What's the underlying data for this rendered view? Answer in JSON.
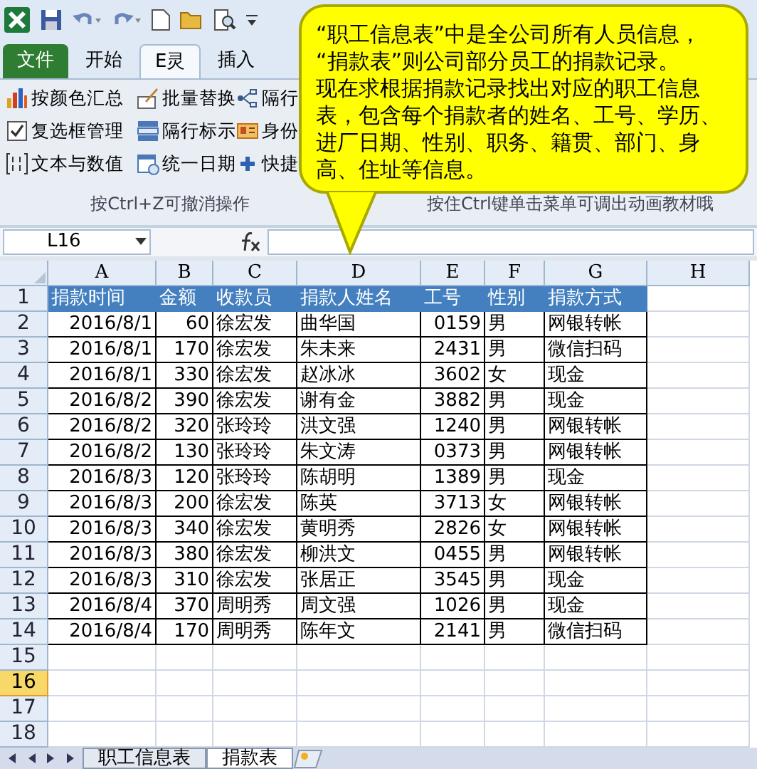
{
  "ribbon": {
    "tabs": [
      {
        "label": "文件",
        "kind": "file",
        "selected": false
      },
      {
        "label": "开始",
        "kind": "tab",
        "selected": false
      },
      {
        "label": "E灵",
        "kind": "tab",
        "selected": true
      },
      {
        "label": "插入",
        "kind": "tab",
        "selected": false
      }
    ],
    "commands": [
      {
        "label": "按颜色汇总",
        "kind": "bars"
      },
      {
        "label": "批量替换",
        "kind": "abc"
      },
      {
        "label": "隔行",
        "kind": "nodes"
      },
      {
        "label": "复选框管理",
        "kind": "checkbox"
      },
      {
        "label": "隔行标示",
        "kind": "rows"
      },
      {
        "label": "身份",
        "kind": "card"
      },
      {
        "label": "文本与数值",
        "kind": "digits"
      },
      {
        "label": "统一日期",
        "kind": "calendar"
      },
      {
        "label": "快捷",
        "kind": "plus"
      }
    ],
    "group_labels": [
      "按Ctrl+Z可撤消操作",
      "按住Ctrl键单击菜单可调出动画教材哦"
    ]
  },
  "callout": {
    "lines": [
      "“职工信息表”中是全公司所有人员信息，",
      "“捐款表”则公司部分员工的捐款记录。",
      "现在求根据捐款记录找出对应的职工信息",
      "表，包含每个捐款者的姓名、工号、学历、",
      "进厂日期、性别、职务、籍贯、部门、身",
      "高、住址等信息。"
    ]
  },
  "formula_bar": {
    "name_box": "L16"
  },
  "sheet": {
    "columns": [
      {
        "label": "A",
        "kind": "number"
      },
      {
        "label": "B",
        "kind": "number"
      },
      {
        "label": "C",
        "kind": "text"
      },
      {
        "label": "D",
        "kind": "text"
      },
      {
        "label": "E",
        "kind": "number"
      },
      {
        "label": "F",
        "kind": "text"
      },
      {
        "label": "G",
        "kind": "text"
      },
      {
        "label": "H",
        "kind": "text"
      }
    ],
    "row_headers": [
      {
        "label": "1",
        "selected": false
      },
      {
        "label": "2",
        "selected": false
      },
      {
        "label": "3",
        "selected": false
      },
      {
        "label": "4",
        "selected": false
      },
      {
        "label": "5",
        "selected": false
      },
      {
        "label": "6",
        "selected": false
      },
      {
        "label": "7",
        "selected": false
      },
      {
        "label": "8",
        "selected": false
      },
      {
        "label": "9",
        "selected": false
      },
      {
        "label": "10",
        "selected": false
      },
      {
        "label": "11",
        "selected": false
      },
      {
        "label": "12",
        "selected": false
      },
      {
        "label": "13",
        "selected": false
      },
      {
        "label": "14",
        "selected": false
      },
      {
        "label": "15",
        "selected": false
      },
      {
        "label": "16",
        "selected": true
      },
      {
        "label": "17",
        "selected": false
      },
      {
        "label": "18",
        "selected": false
      }
    ],
    "header": [
      "捐款时间",
      "金额",
      "收款员",
      "捐款人姓名",
      "工号",
      "性别",
      "捐款方式"
    ],
    "rows": [
      [
        "2016/8/1",
        "60",
        "徐宏发",
        "曲华国",
        "0159",
        "男",
        "网银转帐"
      ],
      [
        "2016/8/1",
        "170",
        "徐宏发",
        "朱未来",
        "2431",
        "男",
        "微信扫码"
      ],
      [
        "2016/8/1",
        "330",
        "徐宏发",
        "赵冰冰",
        "3602",
        "女",
        "现金"
      ],
      [
        "2016/8/2",
        "390",
        "徐宏发",
        "谢有金",
        "3882",
        "男",
        "现金"
      ],
      [
        "2016/8/2",
        "320",
        "张玲玲",
        "洪文强",
        "1240",
        "男",
        "网银转帐"
      ],
      [
        "2016/8/2",
        "130",
        "张玲玲",
        "朱文涛",
        "0373",
        "男",
        "网银转帐"
      ],
      [
        "2016/8/3",
        "120",
        "张玲玲",
        "陈胡明",
        "1389",
        "男",
        "现金"
      ],
      [
        "2016/8/3",
        "200",
        "徐宏发",
        "陈英",
        "3713",
        "女",
        "网银转帐"
      ],
      [
        "2016/8/3",
        "340",
        "徐宏发",
        "黄明秀",
        "2826",
        "女",
        "网银转帐"
      ],
      [
        "2016/8/3",
        "380",
        "徐宏发",
        "柳洪文",
        "0455",
        "男",
        "网银转帐"
      ],
      [
        "2016/8/3",
        "310",
        "徐宏发",
        "张居正",
        "3545",
        "男",
        "现金"
      ],
      [
        "2016/8/4",
        "370",
        "周明秀",
        "周文强",
        "1026",
        "男",
        "现金"
      ],
      [
        "2016/8/4",
        "170",
        "周明秀",
        "陈年文",
        "2141",
        "男",
        "微信扫码"
      ]
    ]
  },
  "sheet_tabs": [
    {
      "label": "职工信息表",
      "selected": false
    },
    {
      "label": "捐款表",
      "selected": true
    }
  ]
}
